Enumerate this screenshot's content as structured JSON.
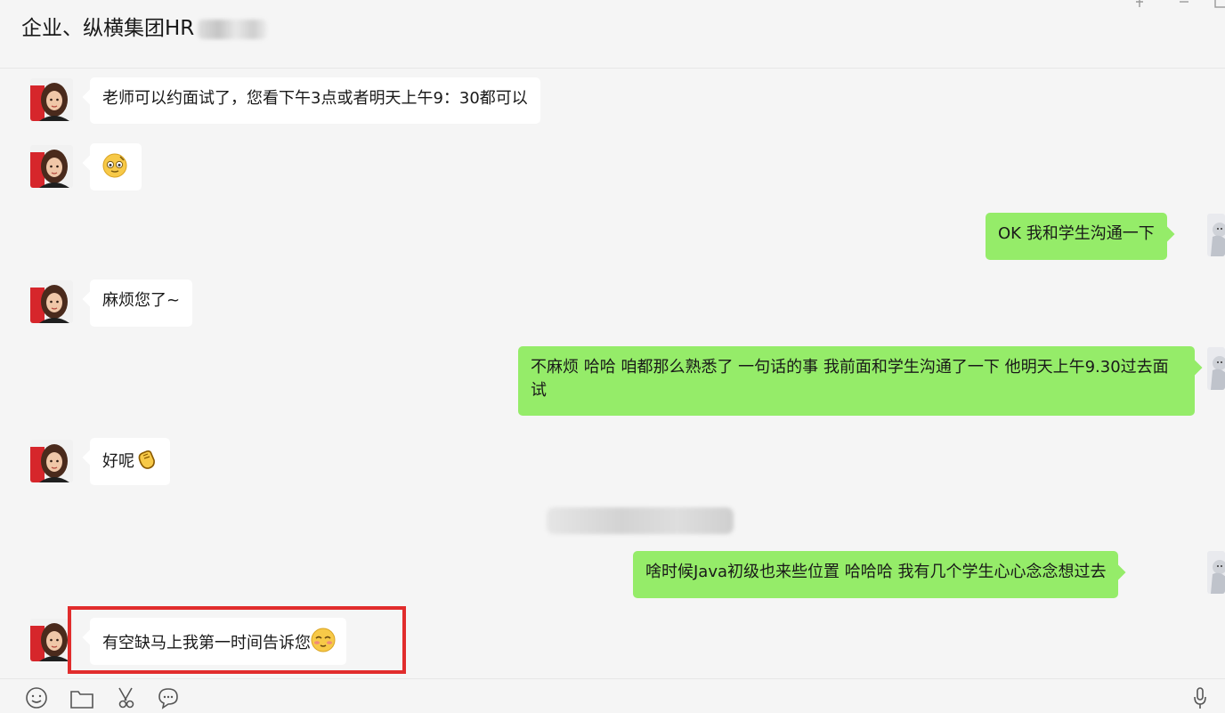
{
  "header": {
    "title": "企业、纵横集团HR",
    "title_blurred_suffix": true,
    "window_controls": [
      "pin-icon",
      "minimize-icon",
      "maximize-icon"
    ]
  },
  "messages": [
    {
      "side": "in",
      "text": "老师可以约面试了，您看下午3点或者明天上午9：30都可以",
      "emoji": null
    },
    {
      "side": "in",
      "text": "",
      "emoji": "smirk-face-emoji"
    },
    {
      "side": "out",
      "text": "OK 我和学生沟通一下",
      "emoji": null
    },
    {
      "side": "in",
      "text": "麻烦您了~",
      "emoji": null
    },
    {
      "side": "out",
      "text": "不麻烦 哈哈 咱都那么熟悉了 一句话的事  我前面和学生沟通了一下 他明天上午9.30过去面试",
      "emoji": null
    },
    {
      "side": "in",
      "text": "好呢",
      "emoji": "clapping-hands-emoji"
    },
    {
      "side": "out",
      "text": "啥时候Java初级也来些位置 哈哈哈 我有几个学生心心念念想过去",
      "emoji": null
    },
    {
      "side": "in",
      "text": "有空缺马上我第一时间告诉您",
      "emoji": "shy-smile-emoji",
      "highlighted": true
    }
  ],
  "timestamp_blurred": true,
  "toolbar": {
    "icons": [
      "emoji-icon",
      "folder-icon",
      "scissors-icon",
      "chat-history-icon",
      "microphone-icon"
    ]
  },
  "colors": {
    "background": "#f5f5f5",
    "incoming_bubble": "#ffffff",
    "outgoing_bubble": "#95ec69",
    "highlight_border": "#e12c2c"
  }
}
